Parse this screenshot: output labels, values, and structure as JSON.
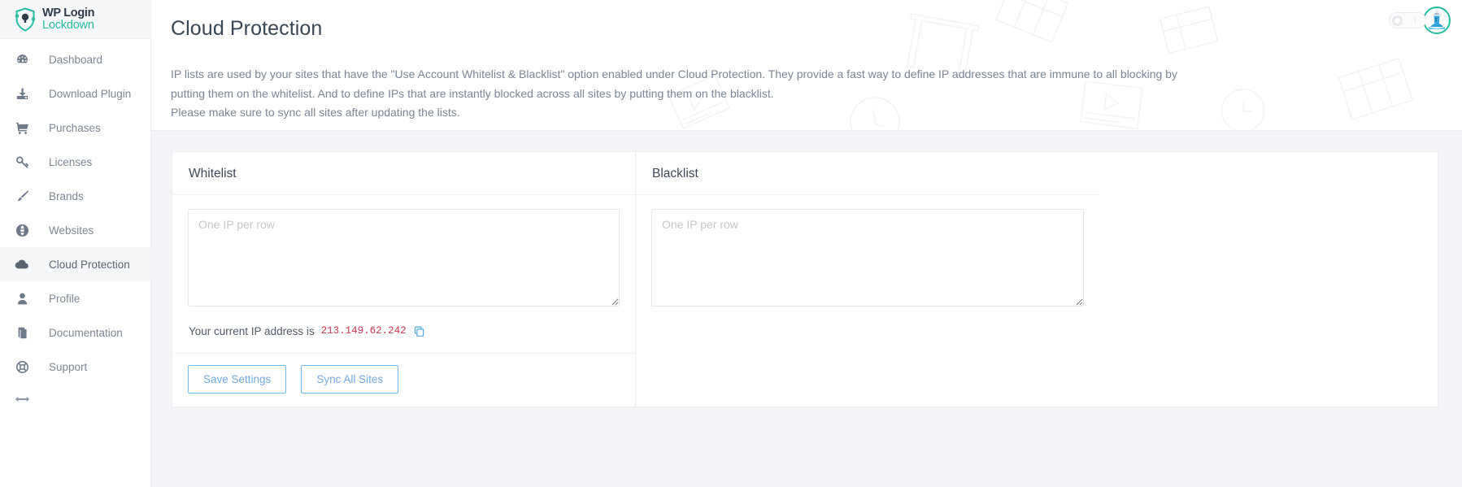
{
  "brand": {
    "line1": "WP Login",
    "line2": "Lockdown",
    "logo_icon": "shield-lock-icon",
    "accent_color": "#27bba0",
    "title_color": "#2f3b4a"
  },
  "sidebar": {
    "items": [
      {
        "label": "Dashboard",
        "icon": "speedometer-icon",
        "active": false
      },
      {
        "label": "Download Plugin",
        "icon": "download-icon",
        "active": false
      },
      {
        "label": "Purchases",
        "icon": "shopping-cart-icon",
        "active": false
      },
      {
        "label": "Licenses",
        "icon": "key-icon",
        "active": false
      },
      {
        "label": "Brands",
        "icon": "paintbrush-icon",
        "active": false
      },
      {
        "label": "Websites",
        "icon": "globe-icon",
        "active": false
      },
      {
        "label": "Cloud Protection",
        "icon": "cloud-icon",
        "active": true
      },
      {
        "label": "Profile",
        "icon": "user-icon",
        "active": false
      },
      {
        "label": "Documentation",
        "icon": "book-icon",
        "active": false
      },
      {
        "label": "Support",
        "icon": "lifebuoy-icon",
        "active": false
      }
    ],
    "collapse_icon": "arrows-left-right-icon"
  },
  "header": {
    "title": "Cloud Protection",
    "description_line1": "IP lists are used by your sites that have the \"Use Account Whitelist & Blacklist\" option enabled under Cloud Protection. They provide a fast way to define IP addresses that are immune to all",
    "description_line2": "blocking by putting them on the whitelist. And to define IPs that are instantly blocked across all sites by putting them on the blacklist.",
    "description_line3": "Please make sure to sync all sites after updating the lists.",
    "avatar_icon": "user-avatar-icon",
    "avatar_ring_color": "#27bba0",
    "toggle_icon": "theme-toggle"
  },
  "whitelist": {
    "title": "Whitelist",
    "textarea_value": "",
    "textarea_placeholder": "One IP per row",
    "ip_label": "Your current IP address is",
    "ip_address": "213.149.62.242",
    "ip_color": "#c7384f",
    "copy_icon": "copy-icon"
  },
  "blacklist": {
    "title": "Blacklist",
    "textarea_value": "",
    "textarea_placeholder": "One IP per row"
  },
  "footer": {
    "save_label": "Save Settings",
    "sync_label": "Sync All Sites",
    "button_color": "#72bdf0"
  }
}
